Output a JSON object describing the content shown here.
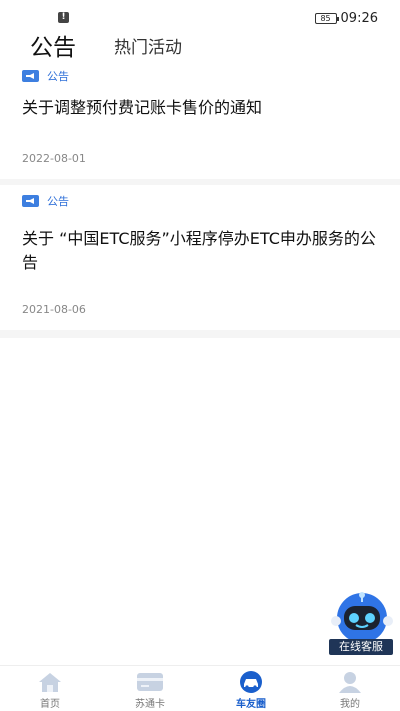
{
  "status_bar": {
    "alert": "!",
    "battery": "85",
    "time": "09:26"
  },
  "header": {
    "tabs": [
      {
        "label": "公告",
        "active": true
      },
      {
        "label": "热门活动",
        "active": false
      }
    ]
  },
  "notices": [
    {
      "tag": "公告",
      "title": "关于调整预付费记账卡售价的通知",
      "date": "2022-08-01"
    },
    {
      "tag": "公告",
      "title": "关于 “中国ETC服务”小程序停办ETC申办服务的公告",
      "date": "2021-08-06"
    }
  ],
  "assistant": {
    "label": "在线客服"
  },
  "tabbar": {
    "items": [
      {
        "label": "首页",
        "icon": "home-icon"
      },
      {
        "label": "苏通卡",
        "icon": "card-icon"
      },
      {
        "label": "车友圈",
        "icon": "car-icon",
        "active": true
      },
      {
        "label": "我的",
        "icon": "person-icon"
      }
    ]
  },
  "colors": {
    "accent": "#1a5fcc",
    "tag_blue": "#3d7fe0"
  }
}
